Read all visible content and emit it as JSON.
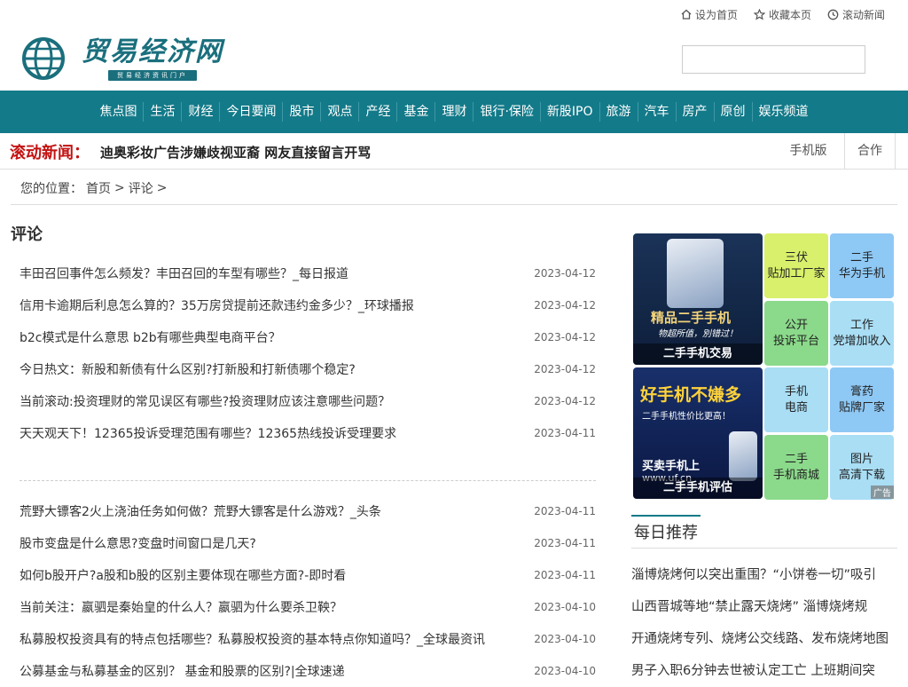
{
  "top_links": [
    {
      "label": "设为首页",
      "icon": "home-icon"
    },
    {
      "label": "收藏本页",
      "icon": "star-icon"
    },
    {
      "label": "滚动新闻",
      "icon": "clock-icon"
    }
  ],
  "brand": {
    "name": "贸易经济网",
    "tagline": "贸易经济资讯门户"
  },
  "nav": [
    "焦点图",
    "生活",
    "财经",
    "今日要闻",
    "股市",
    "观点",
    "产经",
    "基金",
    "理财",
    "银行·保险",
    "新股IPO",
    "旅游",
    "汽车",
    "房产",
    "原创",
    "娱乐频道"
  ],
  "news_bar": {
    "label": "滚动新闻：",
    "headline": "迪奥彩妆广告涉嫌歧视亚裔 网友直接留言开骂",
    "mobile_label": "手机版",
    "coop_label": "合作"
  },
  "breadcrumb": {
    "prefix": "您的位置：",
    "home": "首页",
    "sep": ">",
    "current": "评论"
  },
  "section_title": "评论",
  "articles_group1": [
    {
      "title": "丰田召回事件怎么频发？丰田召回的车型有哪些？_每日报道",
      "date": "2023-04-12"
    },
    {
      "title": "信用卡逾期后利息怎么算的？35万房贷提前还款违约金多少？_环球播报",
      "date": "2023-04-12"
    },
    {
      "title": "b2c模式是什么意思 b2b有哪些典型电商平台？",
      "date": "2023-04-12"
    },
    {
      "title": "今日热文：新股和新债有什么区别?打新股和打新债哪个稳定?",
      "date": "2023-04-12"
    },
    {
      "title": "当前滚动:投资理财的常见误区有哪些?投资理财应该注意哪些问题？",
      "date": "2023-04-12"
    },
    {
      "title": "天天观天下！12365投诉受理范围有哪些？12365热线投诉受理要求",
      "date": "2023-04-11"
    }
  ],
  "articles_group2": [
    {
      "title": "荒野大镖客2火上浇油任务如何做？荒野大镖客是什么游戏？_头条",
      "date": "2023-04-11"
    },
    {
      "title": "股市变盘是什么意思?变盘时间窗口是几天?",
      "date": "2023-04-11"
    },
    {
      "title": "如何b股开户?a股和b股的区别主要体现在哪些方面?-即时看",
      "date": "2023-04-11"
    },
    {
      "title": "当前关注：嬴驷是秦始皇的什么人？嬴驷为什么要杀卫鞅？",
      "date": "2023-04-10"
    },
    {
      "title": "私募股权投资具有的特点包括哪些？私募股权投资的基本特点你知道吗？_全球最资讯",
      "date": "2023-04-10"
    },
    {
      "title": "公募基金与私募基金的区别？ 基金和股票的区别?|全球速递",
      "date": "2023-04-10"
    }
  ],
  "ads": {
    "img1": {
      "big": "精品二手手机",
      "sub": "物超所值，別错过！",
      "caption": "二手手机交易"
    },
    "img2": {
      "big": "好手机不嫌多",
      "sub": "二手手机性价比更高！",
      "mid": "买卖手机上",
      "url": "www.uf.cn",
      "caption": "二手手机评估"
    },
    "tiles": [
      {
        "l1": "三伏",
        "l2": "贴加工厂家"
      },
      {
        "l1": "二手",
        "l2": "华为手机"
      },
      {
        "l1": "公开",
        "l2": "投诉平台"
      },
      {
        "l1": "工作",
        "l2": "党增加收入"
      },
      {
        "l1": "手机",
        "l2": "电商"
      },
      {
        "l1": "膏药",
        "l2": "贴牌厂家"
      },
      {
        "l1": "二手",
        "l2": "手机商城"
      },
      {
        "l1": "图片",
        "l2": "高清下载"
      }
    ],
    "ad_tag": "广告"
  },
  "daily": {
    "title": "每日推荐",
    "items": [
      "淄博烧烤何以突出重围？“小饼卷一切”吸引",
      "山西晋城等地“禁止露天烧烤” 淄博烧烤规",
      "开通烧烤专列、烧烤公交线路、发布烧烤地图",
      "男子入职6分钟去世被认定工亡 上班期间突"
    ]
  },
  "colors": {
    "nav_bg": "#137a89",
    "news_label": "#c41212"
  }
}
